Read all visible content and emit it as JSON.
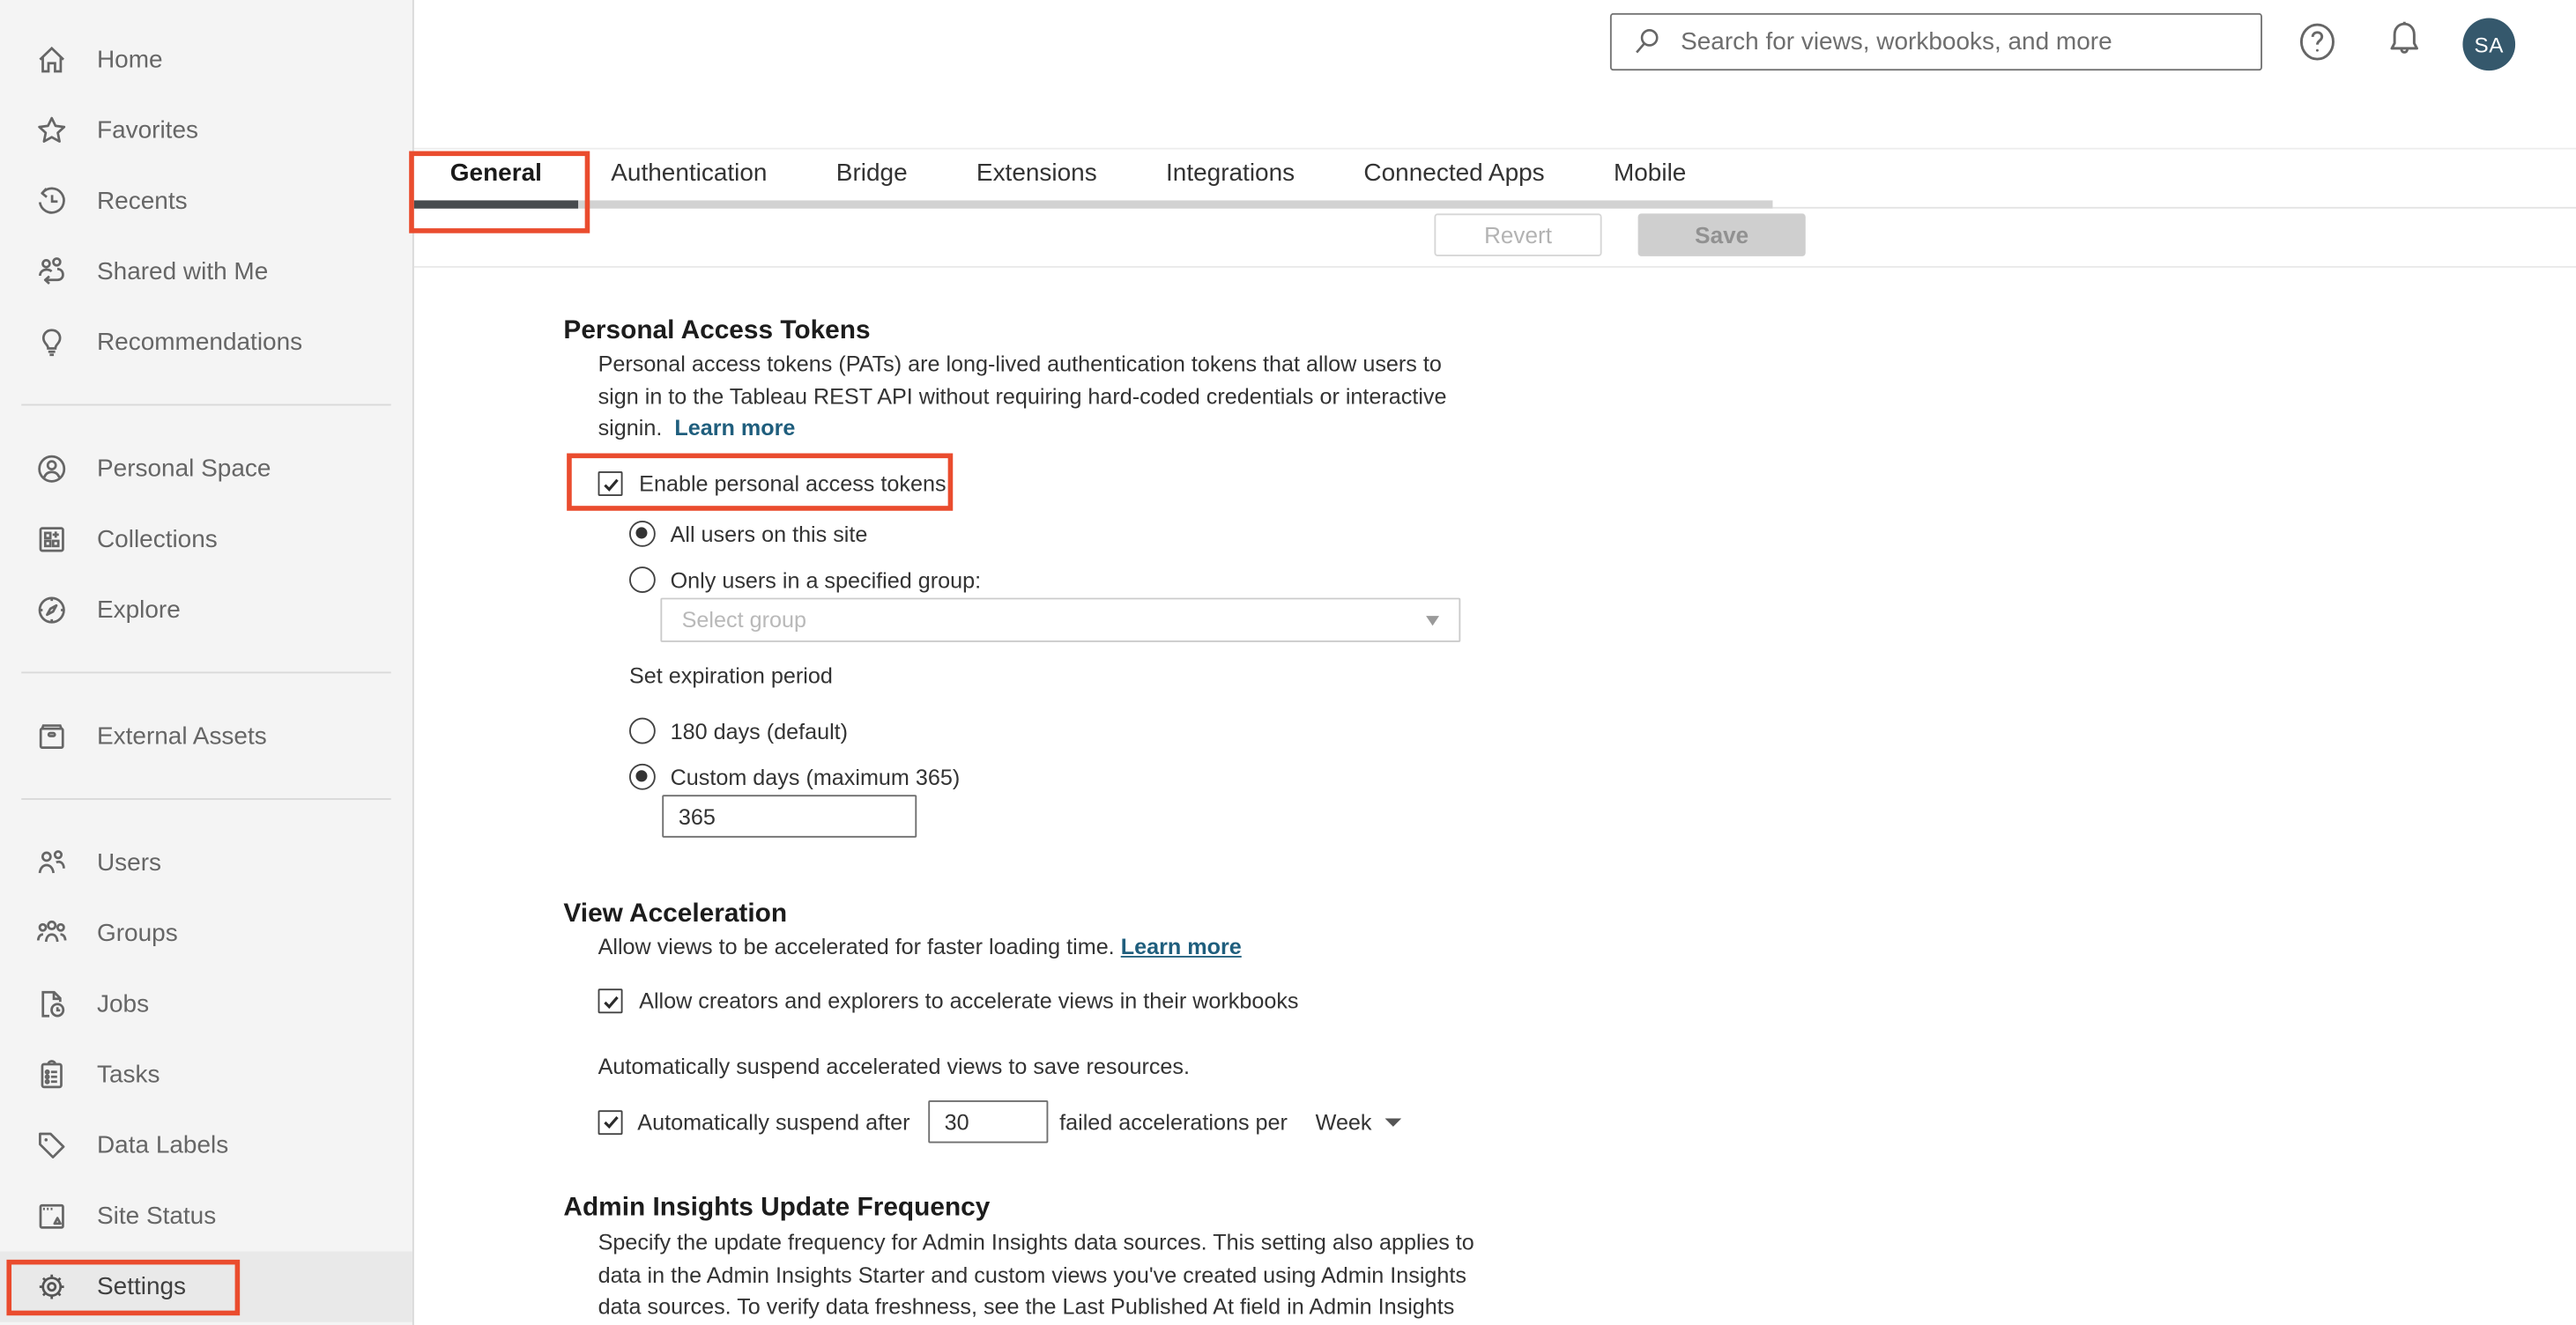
{
  "header": {
    "search_placeholder": "Search for views, workbooks, and more",
    "avatar_initials": "SA"
  },
  "sidebar": {
    "items": [
      {
        "label": "Home",
        "icon": "home-icon"
      },
      {
        "label": "Favorites",
        "icon": "star-icon"
      },
      {
        "label": "Recents",
        "icon": "history-icon"
      },
      {
        "label": "Shared with Me",
        "icon": "shared-icon"
      },
      {
        "label": "Recommendations",
        "icon": "lightbulb-icon"
      },
      {
        "label": "Personal Space",
        "icon": "person-circle-icon"
      },
      {
        "label": "Collections",
        "icon": "collections-icon"
      },
      {
        "label": "Explore",
        "icon": "compass-icon"
      },
      {
        "label": "External Assets",
        "icon": "archive-icon"
      },
      {
        "label": "Users",
        "icon": "users-icon"
      },
      {
        "label": "Groups",
        "icon": "groups-icon"
      },
      {
        "label": "Jobs",
        "icon": "document-clock-icon"
      },
      {
        "label": "Tasks",
        "icon": "clipboard-icon"
      },
      {
        "label": "Data Labels",
        "icon": "tag-icon"
      },
      {
        "label": "Site Status",
        "icon": "site-status-icon"
      },
      {
        "label": "Settings",
        "icon": "gear-icon"
      }
    ],
    "selected": "Settings"
  },
  "tabs": {
    "items": [
      "General",
      "Authentication",
      "Bridge",
      "Extensions",
      "Integrations",
      "Connected Apps",
      "Mobile"
    ],
    "active": "General"
  },
  "toolbar": {
    "revert_label": "Revert",
    "save_label": "Save"
  },
  "sections": {
    "pat": {
      "title": "Personal Access Tokens",
      "description_line1": "Personal access tokens (PATs) are long-lived authentication tokens that allow users to",
      "description_line2": "sign in to the Tableau REST API without requiring hard-coded credentials or interactive",
      "description_line3": "signin.",
      "learn_more_label": "Learn more",
      "enable_checkbox_label": "Enable personal access tokens",
      "enable_checkbox_checked": true,
      "radio_all_users_label": "All users on this site",
      "radio_all_users_selected": true,
      "radio_group_label": "Only users in a specified group:",
      "radio_group_selected": false,
      "group_select_placeholder": "Select group",
      "expiration_label": "Set expiration period",
      "radio_180_label": "180 days (default)",
      "radio_180_selected": false,
      "radio_custom_label": "Custom days (maximum 365)",
      "radio_custom_selected": true,
      "custom_days_value": "365"
    },
    "view_acceleration": {
      "title": "View Acceleration",
      "description": "Allow views to be accelerated for faster loading time.",
      "learn_more_label": "Learn more",
      "allow_checkbox_label": "Allow creators and explorers to accelerate views in their workbooks",
      "allow_checkbox_checked": true,
      "suspend_note": "Automatically suspend accelerated views to save resources.",
      "suspend_checkbox_label": "Automatically suspend after",
      "suspend_checkbox_checked": true,
      "suspend_threshold_value": "30",
      "suspend_tail_label": "failed accelerations per",
      "suspend_period_value": "Week"
    },
    "admin_insights": {
      "title": "Admin Insights Update Frequency",
      "description_line1": "Specify the update frequency for Admin Insights data sources. This setting also applies to",
      "description_line2": "data in the Admin Insights Starter and custom views you've created using Admin Insights",
      "description_line3": "data sources. To verify data freshness, see the Last Published At field in Admin Insights"
    }
  },
  "colors": {
    "annotation_red": "#ea4c2e",
    "link_blue": "#1f5e7d",
    "avatar_bg": "#35586c",
    "active_tab_underline": "#474b4e"
  }
}
